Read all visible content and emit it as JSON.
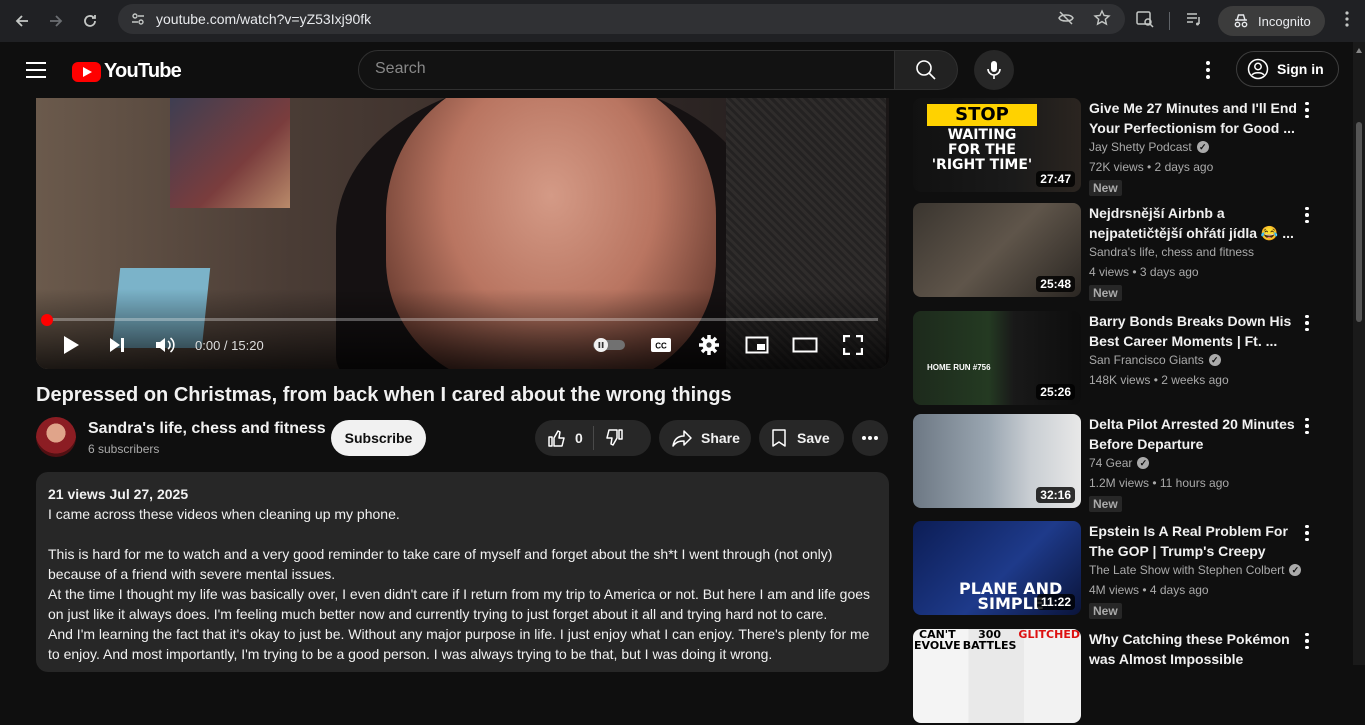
{
  "browser": {
    "url": "youtube.com/watch?v=yZ53Ixj90fk",
    "incognito_label": "Incognito"
  },
  "masthead": {
    "logo_text": "YouTube",
    "search_placeholder": "Search",
    "signin_label": "Sign in"
  },
  "player": {
    "time_display": "0:00 / 15:20",
    "progress_fraction": 0.0
  },
  "video": {
    "title": "Depressed on Christmas, from back when I cared about the wrong things",
    "channel_name": "Sandra's life, chess and fitness",
    "subscribers": "6 subscribers",
    "subscribe_label": "Subscribe",
    "like_count": "0",
    "share_label": "Share",
    "save_label": "Save"
  },
  "description": {
    "meta": "21 views  Jul 27, 2025",
    "text": "I came across these videos when cleaning up my phone.\n\nThis is hard for me to watch and a very good reminder to take care of myself and forget about the sh*t I went through (not only)\nbecause of a friend with severe mental issues.\nAt the time I thought my life was basically over, I even didn't care if I return from my trip to America or not. But here I am and life goes\non just like it always does. I'm feeling much better now and currently trying to just forget about it all and trying hard not to care.\nAnd I'm learning the fact that it's okay to just be. Without any major purpose in life. I just enjoy what I can enjoy. There's plenty for me\nto enjoy. And most importantly, I'm trying to be a good person. I was always trying to be that, but I was doing it wrong."
  },
  "recommendations": [
    {
      "title": "Give Me 27 Minutes and I'll End Your Perfectionism for Good ...",
      "channel": "Jay Shetty Podcast",
      "verified": true,
      "meta": "72K views • 2 days ago",
      "badge": "New",
      "duration": "27:47",
      "thumb_text": [
        "STOP",
        "WAITING",
        "FOR THE",
        "'RIGHT TIME'"
      ]
    },
    {
      "title": "Nejdrsnější Airbnb a nejpatetičtější ohřátí jídla 😂 ...",
      "channel": "Sandra's life, chess and fitness",
      "verified": false,
      "meta": "4 views • 3 days ago",
      "badge": "New",
      "duration": "25:48"
    },
    {
      "title": "Barry Bonds Breaks Down His Best Career Moments | Ft. ...",
      "channel": "San Francisco Giants",
      "verified": true,
      "meta": "148K views • 2 weeks ago",
      "badge": "",
      "duration": "25:26",
      "thumb_text": [
        "HOME RUN #756"
      ]
    },
    {
      "title": "Delta Pilot Arrested 20 Minutes Before Departure",
      "channel": "74 Gear",
      "verified": true,
      "meta": "1.2M views • 11 hours ago",
      "badge": "New",
      "duration": "32:16"
    },
    {
      "title": "Epstein Is A Real Problem For The GOP | Trump's Creepy Pas...",
      "channel": "The Late Show with Stephen Colbert",
      "verified": true,
      "meta": "4M views • 4 days ago",
      "badge": "New",
      "duration": "11:22",
      "thumb_text": [
        "PLANE AND",
        "SIMPLE"
      ]
    },
    {
      "title": "Why Catching these Pokémon was Almost Impossible",
      "channel": "",
      "verified": false,
      "meta": "",
      "badge": "",
      "duration": "",
      "thumb_text": [
        "CAN'T",
        "EVOLVE",
        "300",
        "BATTLES",
        "GLITCHED"
      ]
    }
  ],
  "colors": {
    "background": "#0f0f0f",
    "brand_red": "#ff0000",
    "surface": "#272727"
  }
}
